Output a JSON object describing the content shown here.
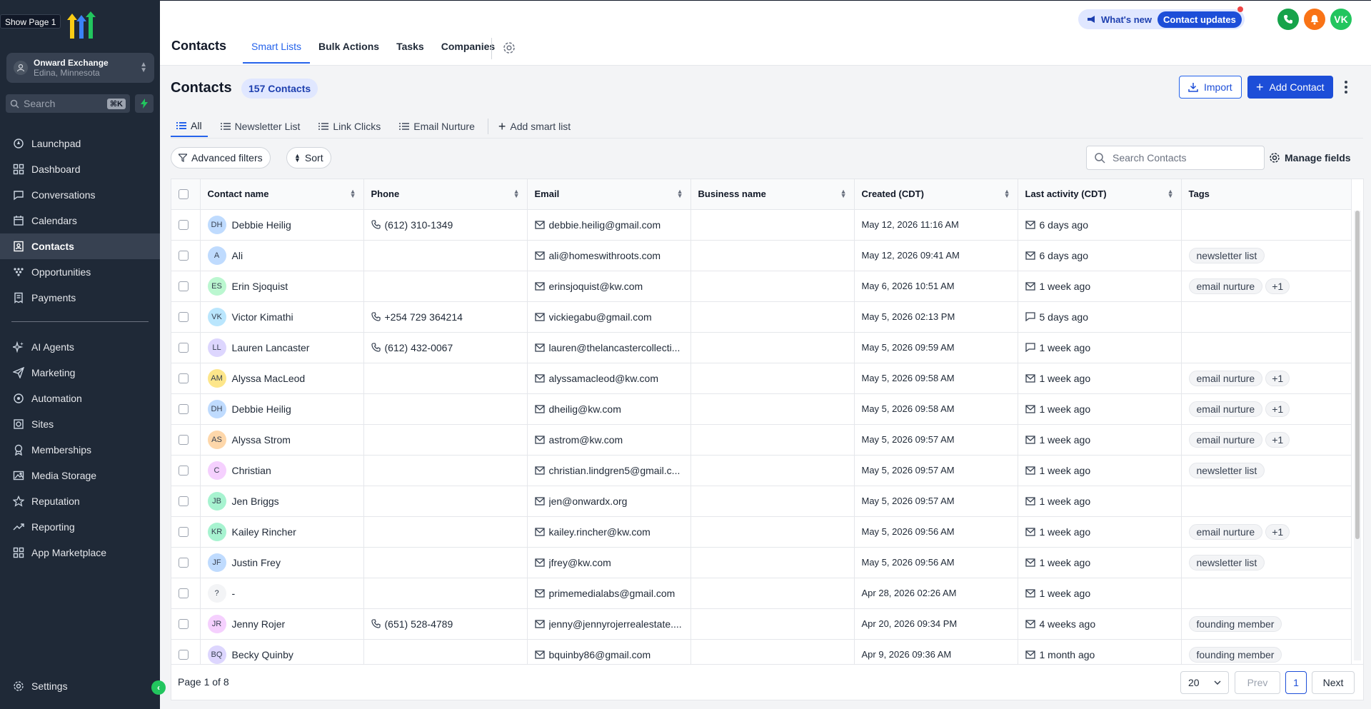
{
  "sidebar": {
    "show_page": "Show Page 1",
    "location": {
      "name": "Onward Exchange",
      "city": "Edina, Minnesota"
    },
    "search": {
      "placeholder": "Search",
      "shortcut": "⌘K"
    },
    "nav_primary": [
      {
        "label": "Launchpad",
        "icon": "rocket-icon"
      },
      {
        "label": "Dashboard",
        "icon": "grid-icon"
      },
      {
        "label": "Conversations",
        "icon": "chat-icon"
      },
      {
        "label": "Calendars",
        "icon": "calendar-icon"
      },
      {
        "label": "Contacts",
        "icon": "contacts-icon",
        "active": true
      },
      {
        "label": "Opportunities",
        "icon": "funnel-icon"
      },
      {
        "label": "Payments",
        "icon": "receipt-icon"
      }
    ],
    "nav_secondary": [
      {
        "label": "AI Agents",
        "icon": "sparkle-icon"
      },
      {
        "label": "Marketing",
        "icon": "send-icon"
      },
      {
        "label": "Automation",
        "icon": "automation-icon"
      },
      {
        "label": "Sites",
        "icon": "globe-icon"
      },
      {
        "label": "Memberships",
        "icon": "badge-icon"
      },
      {
        "label": "Media Storage",
        "icon": "image-icon"
      },
      {
        "label": "Reputation",
        "icon": "star-icon"
      },
      {
        "label": "Reporting",
        "icon": "trend-icon"
      },
      {
        "label": "App Marketplace",
        "icon": "apps-icon"
      }
    ],
    "settings_label": "Settings"
  },
  "topbar": {
    "title": "Contacts",
    "tabs": [
      "Smart Lists",
      "Bulk Actions",
      "Tasks",
      "Companies"
    ],
    "whats_new": "What's new",
    "contact_updates": "Contact updates",
    "avatar_initials": "VK",
    "colors": {
      "phone": "#16a34a",
      "bell": "#f97316",
      "avatar": "#22c55e"
    }
  },
  "main": {
    "title": "Contacts",
    "count": "157 Contacts",
    "import_label": "Import",
    "add_label": "Add Contact",
    "smart_tabs": [
      "All",
      "Newsletter List",
      "Link Clicks",
      "Email Nurture"
    ],
    "add_smart_list": "Add smart list",
    "advanced_filters": "Advanced filters",
    "sort": "Sort",
    "search_placeholder": "Search Contacts",
    "manage_fields": "Manage fields"
  },
  "table": {
    "columns": [
      "Contact name",
      "Phone",
      "Email",
      "Business name",
      "Created (CDT)",
      "Last activity (CDT)",
      "Tags"
    ],
    "rows": [
      {
        "initials": "DH",
        "color": "#bfdbfe",
        "name": "Debbie Heilig",
        "phone": "(612) 310-1349",
        "email": "debbie.heilig@gmail.com",
        "business": "",
        "created": "May 12, 2026 11:16 AM",
        "activity_icon": "mail",
        "activity": "6 days ago",
        "tags": []
      },
      {
        "initials": "A",
        "color": "#bfdbfe",
        "name": "Ali",
        "phone": "",
        "email": "ali@homeswithroots.com",
        "business": "",
        "created": "May 12, 2026 09:41 AM",
        "activity_icon": "mail",
        "activity": "6 days ago",
        "tags": [
          "newsletter list"
        ]
      },
      {
        "initials": "ES",
        "color": "#bbf7d0",
        "name": "Erin Sjoquist",
        "phone": "",
        "email": "erinsjoquist@kw.com",
        "business": "",
        "created": "May 6, 2026 10:51 AM",
        "activity_icon": "mail",
        "activity": "1 week ago",
        "tags": [
          "email nurture",
          "+1"
        ]
      },
      {
        "initials": "VK",
        "color": "#bae6fd",
        "name": "Victor Kimathi",
        "phone": "+254 729 364214",
        "email": "vickiegabu@gmail.com",
        "business": "",
        "created": "May 5, 2026 02:13 PM",
        "activity_icon": "chat",
        "activity": "5 days ago",
        "tags": []
      },
      {
        "initials": "LL",
        "color": "#ddd6fe",
        "name": "Lauren Lancaster",
        "phone": "(612) 432-0067",
        "email": "lauren@thelancastercollecti...",
        "business": "",
        "created": "May 5, 2026 09:59 AM",
        "activity_icon": "chat",
        "activity": "1 week ago",
        "tags": []
      },
      {
        "initials": "AM",
        "color": "#fde68a",
        "name": "Alyssa MacLeod",
        "phone": "",
        "email": "alyssamacleod@kw.com",
        "business": "",
        "created": "May 5, 2026 09:58 AM",
        "activity_icon": "mail",
        "activity": "1 week ago",
        "tags": [
          "email nurture",
          "+1"
        ]
      },
      {
        "initials": "DH",
        "color": "#bfdbfe",
        "name": "Debbie Heilig",
        "phone": "",
        "email": "dheilig@kw.com",
        "business": "",
        "created": "May 5, 2026 09:58 AM",
        "activity_icon": "mail",
        "activity": "1 week ago",
        "tags": [
          "email nurture",
          "+1"
        ]
      },
      {
        "initials": "AS",
        "color": "#fed7aa",
        "name": "Alyssa Strom",
        "phone": "",
        "email": "astrom@kw.com",
        "business": "",
        "created": "May 5, 2026 09:57 AM",
        "activity_icon": "mail",
        "activity": "1 week ago",
        "tags": [
          "email nurture",
          "+1"
        ]
      },
      {
        "initials": "C",
        "color": "#f5d0fe",
        "name": "Christian",
        "phone": "",
        "email": "christian.lindgren5@gmail.c...",
        "business": "",
        "created": "May 5, 2026 09:57 AM",
        "activity_icon": "mail",
        "activity": "1 week ago",
        "tags": [
          "newsletter list"
        ]
      },
      {
        "initials": "JB",
        "color": "#a7f3d0",
        "name": "Jen Briggs",
        "phone": "",
        "email": "jen@onwardx.org",
        "business": "",
        "created": "May 5, 2026 09:57 AM",
        "activity_icon": "mail",
        "activity": "1 week ago",
        "tags": []
      },
      {
        "initials": "KR",
        "color": "#a7f3d0",
        "name": "Kailey Rincher",
        "phone": "",
        "email": "kailey.rincher@kw.com",
        "business": "",
        "created": "May 5, 2026 09:56 AM",
        "activity_icon": "mail",
        "activity": "1 week ago",
        "tags": [
          "email nurture",
          "+1"
        ]
      },
      {
        "initials": "JF",
        "color": "#bfdbfe",
        "name": "Justin Frey",
        "phone": "",
        "email": "jfrey@kw.com",
        "business": "",
        "created": "May 5, 2026 09:56 AM",
        "activity_icon": "mail",
        "activity": "1 week ago",
        "tags": [
          "newsletter list"
        ]
      },
      {
        "initials": "?",
        "color": "#f3f4f6",
        "name": "-",
        "phone": "",
        "email": "primemedialabs@gmail.com",
        "business": "",
        "created": "Apr 28, 2026 02:26 AM",
        "activity_icon": "mail",
        "activity": "1 week ago",
        "tags": []
      },
      {
        "initials": "JR",
        "color": "#f5d0fe",
        "name": "Jenny Rojer",
        "phone": "(651) 528-4789",
        "email": "jenny@jennyrojerrealestate....",
        "business": "",
        "created": "Apr 20, 2026 09:34 PM",
        "activity_icon": "mail",
        "activity": "4 weeks ago",
        "tags": [
          "founding member"
        ]
      },
      {
        "initials": "BQ",
        "color": "#ddd6fe",
        "name": "Becky Quinby",
        "phone": "",
        "email": "bquinby86@gmail.com",
        "business": "",
        "created": "Apr 9, 2026 09:36 AM",
        "activity_icon": "mail",
        "activity": "1 month ago",
        "tags": [
          "founding member"
        ]
      }
    ]
  },
  "pagination": {
    "page_of": "Page 1 of 8",
    "per_page": "20",
    "prev": "Prev",
    "current": "1",
    "next": "Next"
  }
}
